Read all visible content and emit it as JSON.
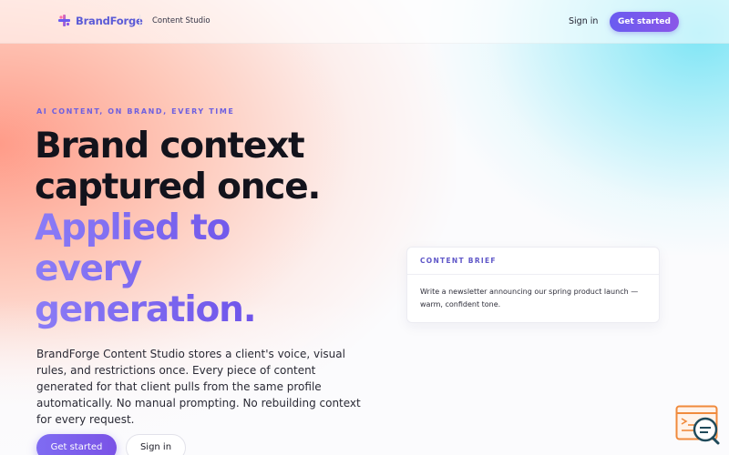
{
  "header": {
    "brand": "BrandForge",
    "product": "Content Studio",
    "sign_in": "Sign in",
    "cta": "Get started"
  },
  "hero": {
    "eyebrow": "AI CONTENT, ON BRAND, EVERY TIME",
    "headline_line1": "Brand context",
    "headline_line2": "captured once.",
    "headline_accent1": "Applied to",
    "headline_accent2": "every",
    "headline_accent3": "generation.",
    "body": "BrandForge Content Studio stores a client's voice, visual rules, and restrictions once. Every piece of content generated for that client pulls from the same profile automatically. No manual prompting. No rebuilding context for every request.",
    "primary_cta": "Get started",
    "secondary_cta": "Sign in"
  },
  "brief_card": {
    "label": "CONTENT BRIEF",
    "text": "Write a newsletter announcing our spring product launch — warm, confident tone."
  },
  "icons": {
    "logo": "brandforge-logo-icon",
    "widget": "support-chat-icon"
  },
  "colors": {
    "accent": "#6a5cf0",
    "accent_purple": "#7a52e6",
    "warm_glow": "#ff9682",
    "cool_glow": "#78e4f5"
  }
}
